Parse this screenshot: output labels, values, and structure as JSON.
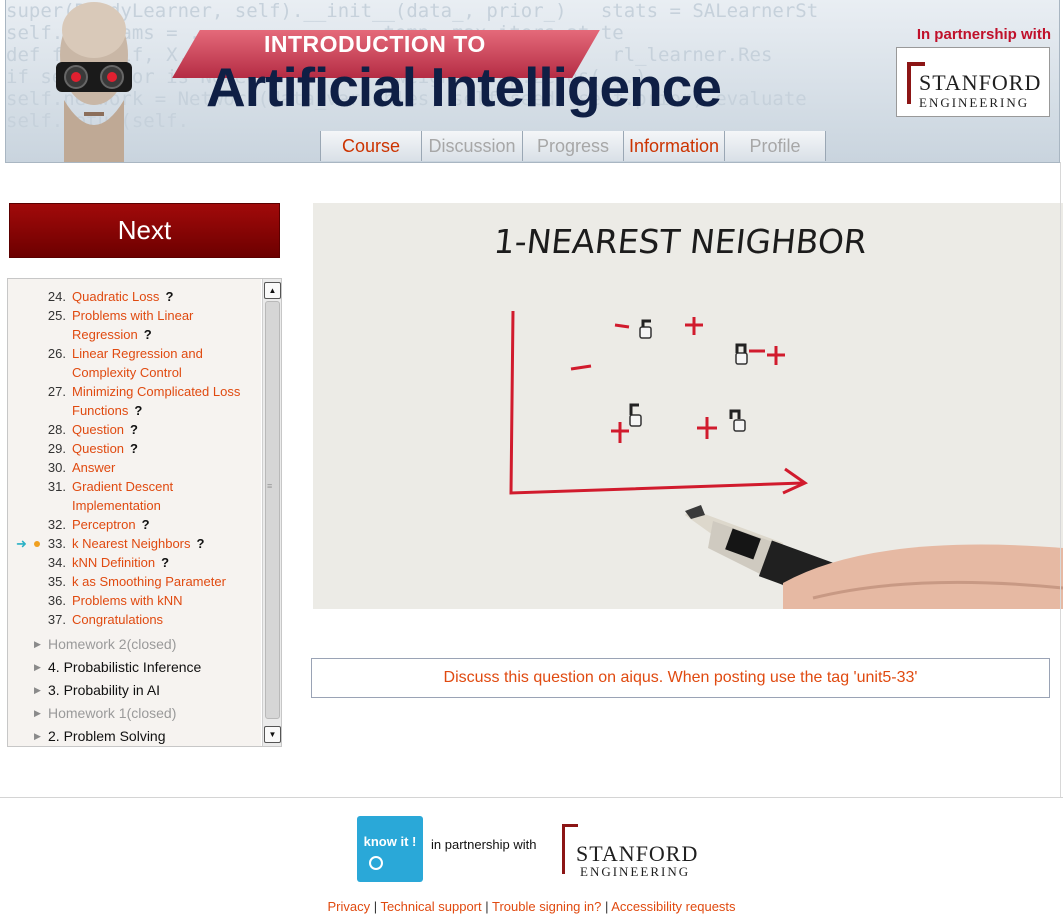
{
  "header": {
    "code_lines": [
      "super(ReadyLearner, self).__init__(data_, prior_)   stats = SALearnerSt",
      "self.n_params = ...              temp, max_iters at te",
      "def fit(self, X, y):                                 rl_learner.Res",
      "if self.prior is None:            weight = np.zeros(...)",
      "self.network = Network(data_variables, self.seed, self.prior) evaluate",
      "self.setup(self.                                        "
    ],
    "intro": "INTRODUCTION TO",
    "title": "Artificial Intelligence",
    "partner": "In partnership with",
    "stanford": "STANFORD",
    "engineering": "ENGINEERING",
    "tabs": [
      {
        "label": "Course",
        "state": "active"
      },
      {
        "label": "Discussion",
        "state": "inactive"
      },
      {
        "label": "Progress",
        "state": "inactive"
      },
      {
        "label": "Information",
        "state": "active"
      },
      {
        "label": "Profile",
        "state": "inactive"
      }
    ]
  },
  "next_label": "Next",
  "outline": {
    "items": [
      {
        "num": "24.",
        "lines": [
          "Quadratic Loss"
        ],
        "q": "?"
      },
      {
        "num": "25.",
        "lines": [
          "Problems with Linear",
          "Regression"
        ],
        "q": "?"
      },
      {
        "num": "26.",
        "lines": [
          "Linear Regression and",
          "Complexity Control"
        ],
        "q": ""
      },
      {
        "num": "27.",
        "lines": [
          "Minimizing Complicated Loss",
          "Functions"
        ],
        "q": "?"
      },
      {
        "num": "28.",
        "lines": [
          "Question"
        ],
        "q": "?"
      },
      {
        "num": "29.",
        "lines": [
          "Question"
        ],
        "q": "?"
      },
      {
        "num": "30.",
        "lines": [
          "Answer"
        ],
        "q": ""
      },
      {
        "num": "31.",
        "lines": [
          "Gradient Descent",
          "Implementation"
        ],
        "q": ""
      },
      {
        "num": "32.",
        "lines": [
          "Perceptron"
        ],
        "q": "?"
      },
      {
        "num": "33.",
        "lines": [
          "k Nearest Neighbors"
        ],
        "q": "?",
        "current": true
      },
      {
        "num": "34.",
        "lines": [
          "kNN Definition"
        ],
        "q": "?"
      },
      {
        "num": "35.",
        "lines": [
          "k as Smoothing Parameter"
        ],
        "q": ""
      },
      {
        "num": "36.",
        "lines": [
          "Problems with kNN"
        ],
        "q": ""
      },
      {
        "num": "37.",
        "lines": [
          "Congratulations"
        ],
        "q": ""
      }
    ],
    "units": [
      {
        "label": "Homework 2(closed)",
        "state": "closed"
      },
      {
        "label": "4. Probabilistic Inference",
        "state": "open"
      },
      {
        "label": "3. Probability in AI",
        "state": "open"
      },
      {
        "label": "Homework 1(closed)",
        "state": "closed"
      },
      {
        "label": "2. Problem Solving",
        "state": "open"
      }
    ]
  },
  "video": {
    "heading": "1-NEAREST NEIGHBOR"
  },
  "discuss_text": "Discuss this question on aiqus. When posting use the tag 'unit5-33'",
  "footer": {
    "knowit": "know it !",
    "partner": "in partnership with",
    "stanford": "STANFORD",
    "engineering": "ENGINEERING",
    "links": [
      "Privacy",
      "Technical support",
      "Trouble signing in?",
      "Accessibility requests"
    ]
  }
}
